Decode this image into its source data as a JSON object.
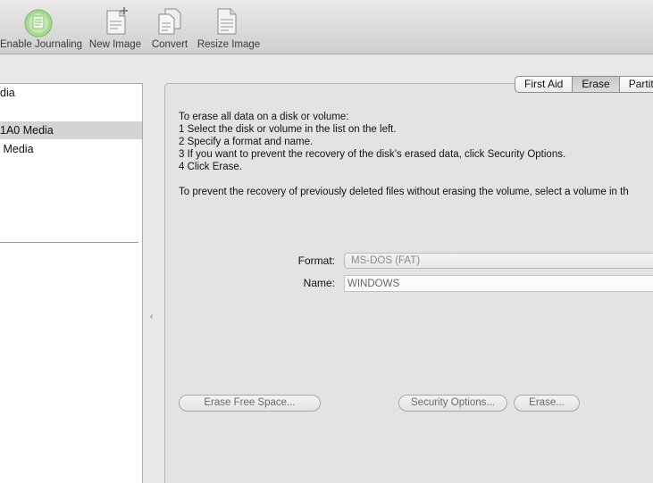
{
  "toolbar": {
    "enable_journaling": "Enable Journaling",
    "new_image": "New Image",
    "convert": "Convert",
    "resize_image": "Resize Image"
  },
  "sidebar": {
    "items": [
      {
        "label": "dia",
        "selected": false
      },
      {
        "label": "1A0 Media",
        "selected": true
      },
      {
        "label": " Media",
        "selected": false
      }
    ]
  },
  "tabs": [
    "First Aid",
    "Erase",
    "Partiti"
  ],
  "active_tab": "Erase",
  "instructions": {
    "line1": "To erase all data on a disk or volume:",
    "line2": "1 Select the disk or volume in the list on the left.",
    "line3": "2 Specify a format and name.",
    "line4": "3 If you want to prevent the recovery of the disk’s erased data, click Security Options.",
    "line5": "4 Click Erase.",
    "line6": "To prevent the recovery of previously deleted files without erasing the volume, select a volume in th"
  },
  "form": {
    "format_label": "Format:",
    "format_value": "MS-DOS (FAT)",
    "name_label": "Name:",
    "name_value": "WINDOWS"
  },
  "buttons": {
    "erase_free_space": "Erase Free Space...",
    "security_options": "Security Options...",
    "erase": "Erase..."
  },
  "colors": {
    "selection": "#d4d4d4",
    "pane_background": "#e3e3e3",
    "journaling_icon": "#8fcf7a"
  }
}
